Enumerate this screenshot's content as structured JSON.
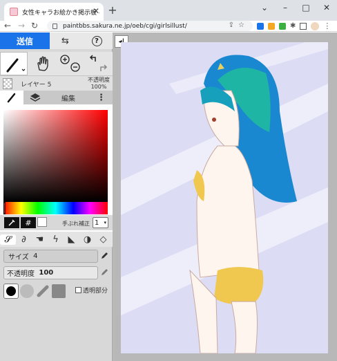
{
  "browser": {
    "tab_title": "女性キャラお絵かき掲示板 - お絵かき",
    "new_tab": "+",
    "url": "paintbbs.sakura.ne.jp/oeb/cgi/girlsillust/",
    "window_controls": [
      "⌄",
      "–",
      "□",
      "✕"
    ]
  },
  "app": {
    "send_label": "送信",
    "swap_icon": "⇆",
    "help_icon": "?",
    "layer": {
      "name": "レイヤー 5",
      "opacity_label": "不透明度",
      "opacity_value": "100%"
    },
    "tabs": {
      "edit_label": "編集",
      "more_label": "⋮"
    },
    "color": {
      "hex_button": "#",
      "stabilizer_label": "手ぶれ補正",
      "stabilizer_value": "1"
    },
    "brush": {
      "size_label": "サイズ",
      "size_value": "4",
      "opacity_label": "不透明度",
      "opacity_value": "100",
      "transparent_label": "透明部分"
    },
    "collapse_icon": "◂|",
    "colors": {
      "accent": "#1a73e8",
      "current_color": "#000000"
    }
  }
}
